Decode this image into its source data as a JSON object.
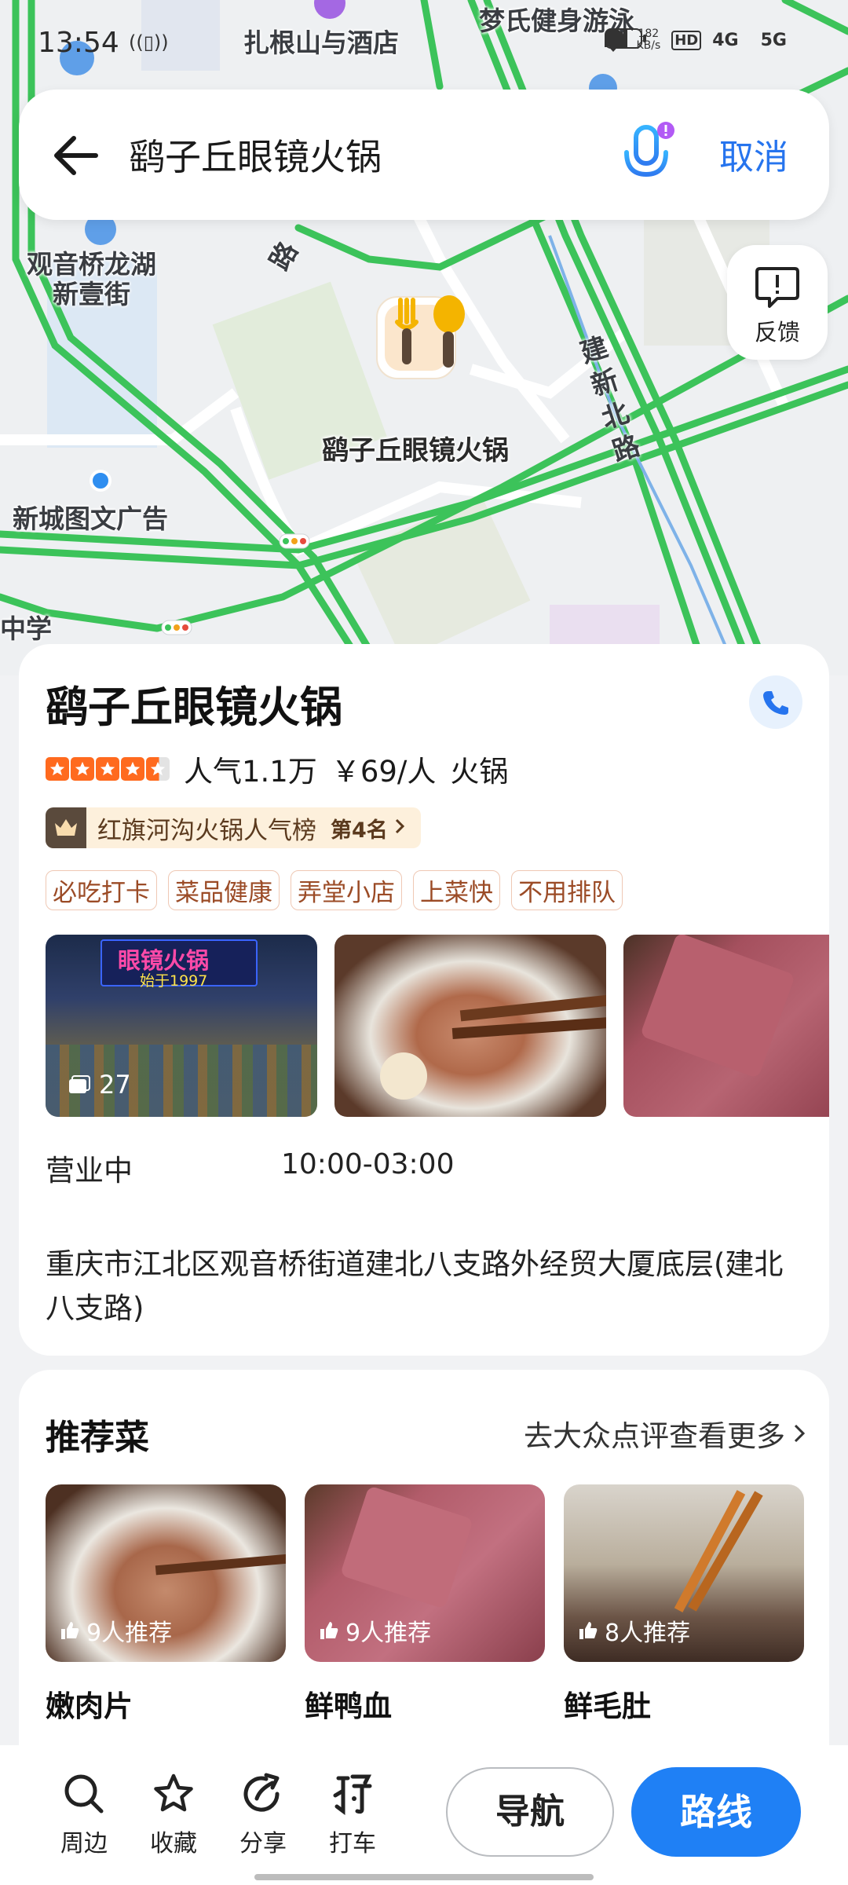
{
  "status_bar": {
    "time": "13:54",
    "net_speed": "182",
    "net_unit": "KB/s",
    "hd_label": "HD",
    "network_a": "4G",
    "network_b": "5G"
  },
  "search": {
    "query": "鹞子丘眼镜火锅",
    "cancel_label": "取消"
  },
  "map": {
    "labels": {
      "poi_top_1": "扎根山与酒店",
      "poi_top_2": "梦氏健身游泳",
      "poi_left": "观音桥龙湖\n新壹街",
      "poi_left_2": "新城图文广告",
      "poi_bottom": "中学",
      "road_1": "建新北路",
      "road_2": "路"
    },
    "marker_label": "鹞子丘眼镜火锅",
    "feedback_label": "反馈"
  },
  "detail": {
    "title": "鹞子丘眼镜火锅",
    "rating_stars": 4.5,
    "popularity": "人气1.1万",
    "price": "￥69/人",
    "category": "火锅",
    "rank_list": "红旗河沟火锅人气榜",
    "rank_position": "第4名",
    "tags": [
      "必吃打卡",
      "菜品健康",
      "弄堂小店",
      "上菜快",
      "不用排队"
    ],
    "photo_count": "27",
    "storefront_sign": "眼镜火锅",
    "storefront_year": "始于1997",
    "hours_status": "营业中",
    "hours": "10:00-03:00",
    "address": "重庆市江北区观音桥街道建北八支路外经贸大厦底层(建北八支路)"
  },
  "recommended": {
    "title": "推荐菜",
    "more_label": "去大众点评查看更多",
    "dishes": [
      {
        "name": "嫩肉片",
        "recommend": "9人推荐"
      },
      {
        "name": "鲜鸭血",
        "recommend": "9人推荐"
      },
      {
        "name": "鲜毛肚",
        "recommend": "8人推荐"
      }
    ]
  },
  "toolbar": {
    "nearby": "周边",
    "favorite": "收藏",
    "share": "分享",
    "taxi": "打车",
    "navigate": "导航",
    "route": "路线"
  },
  "colors": {
    "accent": "#1f80f5",
    "road_green": "#3cc35a",
    "star": "#ff6a1e"
  }
}
